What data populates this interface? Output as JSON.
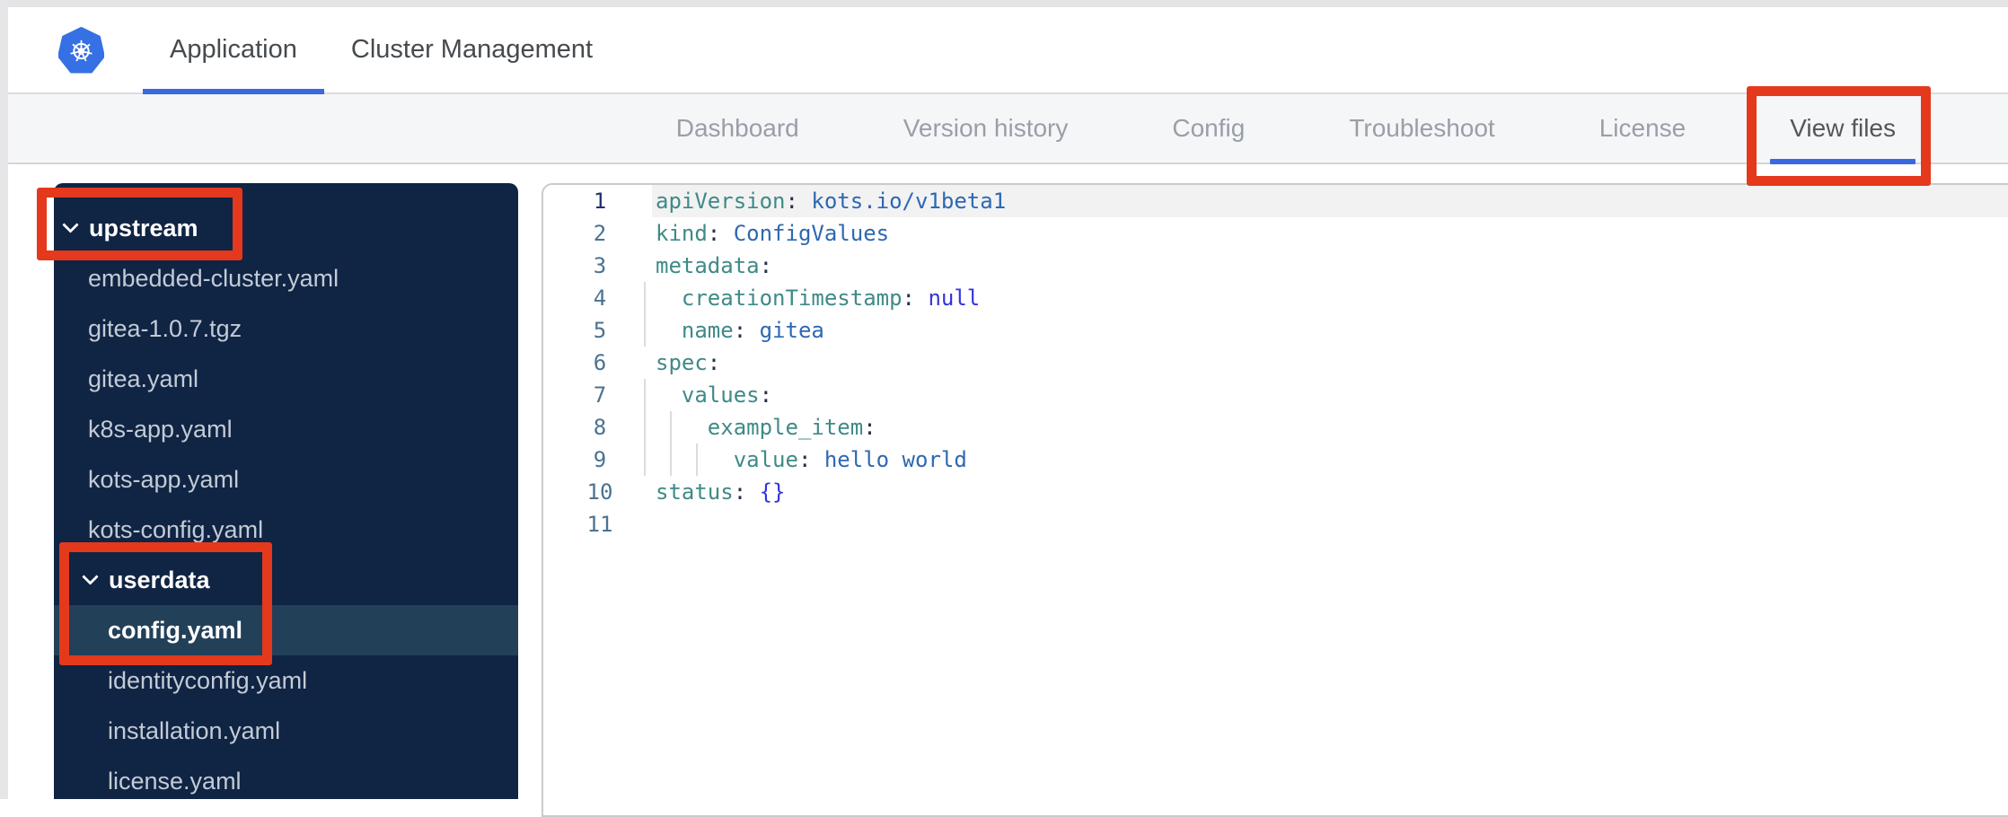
{
  "colors": {
    "accent_blue": "#3a68de",
    "annotation_red": "#e4391c",
    "sidebar_bg": "#102444",
    "sidebar_selected_bg": "#234059",
    "subnav_bg": "#f5f6f8",
    "logo_blue": "#3570e4"
  },
  "header": {
    "logo": "kubernetes",
    "tabs": [
      {
        "label": "Application",
        "active": true
      },
      {
        "label": "Cluster Management",
        "active": false
      }
    ]
  },
  "subnav": {
    "items": [
      {
        "label": "Dashboard",
        "active": false
      },
      {
        "label": "Version history",
        "active": false
      },
      {
        "label": "Config",
        "active": false
      },
      {
        "label": "Troubleshoot",
        "active": false
      },
      {
        "label": "License",
        "active": false
      },
      {
        "label": "View files",
        "active": true
      }
    ]
  },
  "sidebar": {
    "tree": [
      {
        "label": "upstream",
        "type": "folder",
        "level": 0,
        "expanded": true,
        "selected": false
      },
      {
        "label": "embedded-cluster.yaml",
        "type": "file",
        "level": 1,
        "selected": false
      },
      {
        "label": "gitea-1.0.7.tgz",
        "type": "file",
        "level": 1,
        "selected": false
      },
      {
        "label": "gitea.yaml",
        "type": "file",
        "level": 1,
        "selected": false
      },
      {
        "label": "k8s-app.yaml",
        "type": "file",
        "level": 1,
        "selected": false
      },
      {
        "label": "kots-app.yaml",
        "type": "file",
        "level": 1,
        "selected": false
      },
      {
        "label": "kots-config.yaml",
        "type": "file",
        "level": 1,
        "selected": false
      },
      {
        "label": "userdata",
        "type": "folder",
        "level": 1,
        "expanded": true,
        "selected": false
      },
      {
        "label": "config.yaml",
        "type": "file",
        "level": 2,
        "selected": true
      },
      {
        "label": "identityconfig.yaml",
        "type": "file",
        "level": 2,
        "selected": false
      },
      {
        "label": "installation.yaml",
        "type": "file",
        "level": 2,
        "selected": false
      },
      {
        "label": "license.yaml",
        "type": "file",
        "level": 2,
        "selected": false
      }
    ]
  },
  "editor": {
    "lines": [
      {
        "num": "1",
        "active": true,
        "guides": 0,
        "tokens": [
          [
            "apiVersion",
            "k"
          ],
          [
            ":",
            "c"
          ],
          [
            " ",
            "p"
          ],
          [
            "kots.io/v1beta1",
            "v"
          ]
        ]
      },
      {
        "num": "2",
        "active": false,
        "guides": 0,
        "tokens": [
          [
            "kind",
            "k"
          ],
          [
            ":",
            "c"
          ],
          [
            " ",
            "p"
          ],
          [
            "ConfigValues",
            "v"
          ]
        ]
      },
      {
        "num": "3",
        "active": false,
        "guides": 0,
        "tokens": [
          [
            "metadata",
            "k"
          ],
          [
            ":",
            "c"
          ]
        ]
      },
      {
        "num": "4",
        "active": false,
        "guides": 1,
        "tokens": [
          [
            "  ",
            "p"
          ],
          [
            "creationTimestamp",
            "k"
          ],
          [
            ":",
            "c"
          ],
          [
            " ",
            "p"
          ],
          [
            "null",
            "a"
          ]
        ]
      },
      {
        "num": "5",
        "active": false,
        "guides": 1,
        "tokens": [
          [
            "  ",
            "p"
          ],
          [
            "name",
            "k"
          ],
          [
            ":",
            "c"
          ],
          [
            " ",
            "p"
          ],
          [
            "gitea",
            "v"
          ]
        ]
      },
      {
        "num": "6",
        "active": false,
        "guides": 0,
        "tokens": [
          [
            "spec",
            "k"
          ],
          [
            ":",
            "c"
          ]
        ]
      },
      {
        "num": "7",
        "active": false,
        "guides": 1,
        "tokens": [
          [
            "  ",
            "p"
          ],
          [
            "values",
            "k"
          ],
          [
            ":",
            "c"
          ]
        ]
      },
      {
        "num": "8",
        "active": false,
        "guides": 2,
        "tokens": [
          [
            "    ",
            "p"
          ],
          [
            "example_item",
            "k"
          ],
          [
            ":",
            "c"
          ]
        ]
      },
      {
        "num": "9",
        "active": false,
        "guides": 3,
        "tokens": [
          [
            "      ",
            "p"
          ],
          [
            "value",
            "k"
          ],
          [
            ":",
            "c"
          ],
          [
            " ",
            "p"
          ],
          [
            "hello world",
            "v"
          ]
        ]
      },
      {
        "num": "10",
        "active": false,
        "guides": 0,
        "tokens": [
          [
            "status",
            "k"
          ],
          [
            ":",
            "c"
          ],
          [
            " ",
            "p"
          ],
          [
            "{}",
            "a"
          ]
        ]
      },
      {
        "num": "11",
        "active": false,
        "guides": 0,
        "tokens": []
      }
    ]
  },
  "annotations": {
    "color": "#e4391c",
    "boxes": [
      {
        "target": "view-files-tab"
      },
      {
        "target": "upstream-folder"
      },
      {
        "target": "userdata-config-file"
      }
    ]
  }
}
